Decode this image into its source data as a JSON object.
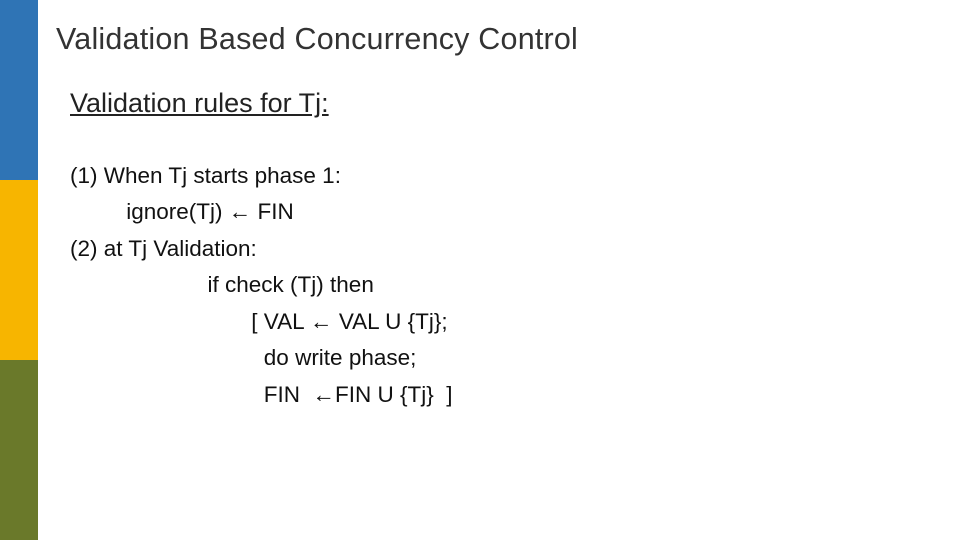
{
  "title": "Validation Based Concurrency Control",
  "subtitle": "Validation rules for Tj:",
  "lines": [
    "(1) When Tj starts phase 1:",
    "         ignore(Tj) ← FIN",
    "(2) at Tj Validation:",
    "                      if check (Tj) then",
    "                             [ VAL ← VAL U {Tj};",
    "                               do write phase;",
    "                               FIN  ←FIN U {Tj}  ]"
  ]
}
